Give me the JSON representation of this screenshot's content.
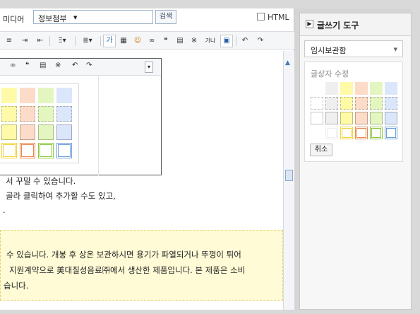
{
  "editor": {
    "media_label": "미디어",
    "select_value": "정보첨부",
    "search_button": "검색",
    "html_label": "HTML"
  },
  "toolbar": {
    "items": [
      "≡",
      "⇥",
      "⇤",
      "Ξ▾",
      "≣▾",
      "가",
      "▦",
      "☺",
      "∞",
      "❝",
      "▤",
      "※",
      "가나",
      "▣",
      "↶",
      "↷"
    ]
  },
  "popup": {
    "items": [
      "∞",
      "❝",
      "▤",
      "※",
      "↶",
      "↷"
    ],
    "scroll_label": "▾"
  },
  "content": {
    "lines": [
      "서 꾸밀 수 있습니다.",
      "골라 클릭하여 추가할 수도 있고,",
      "."
    ],
    "yellow_lines": [
      "수 있습니다. 개봉 후 상온 보관하시면 용기가 파열되거나 뚜껑이 튀어",
      "지원계약으로 美대칠성음료㈜에서 생산한 제품입니다. 본 제품은 소비",
      "습니다."
    ]
  },
  "panel": {
    "title": "글쓰기 도구",
    "select_value": "임시보관함",
    "style_label": "글상자 수정",
    "cancel_button": "취소"
  },
  "colors": {
    "accent": "#4a78c0",
    "swatch_rows": [
      [
        "#ffffff",
        "#efefef",
        "#fffaa8",
        "#fddbc9",
        "#e4f6c0",
        "#dbe6fb"
      ],
      [
        "#ffffff",
        "#efefef",
        "#fffaa8",
        "#fddbc9",
        "#e4f6c0",
        "#dbe6fb"
      ],
      [
        "#ffffff",
        "#efefef",
        "#fffaa8",
        "#fddbc9",
        "#e4f6c0",
        "#dbe6fb"
      ],
      [
        "#ffffff",
        "#efefef",
        "#f2d33b",
        "#e9874f",
        "#8cc83e",
        "#6f9fd8"
      ]
    ]
  }
}
